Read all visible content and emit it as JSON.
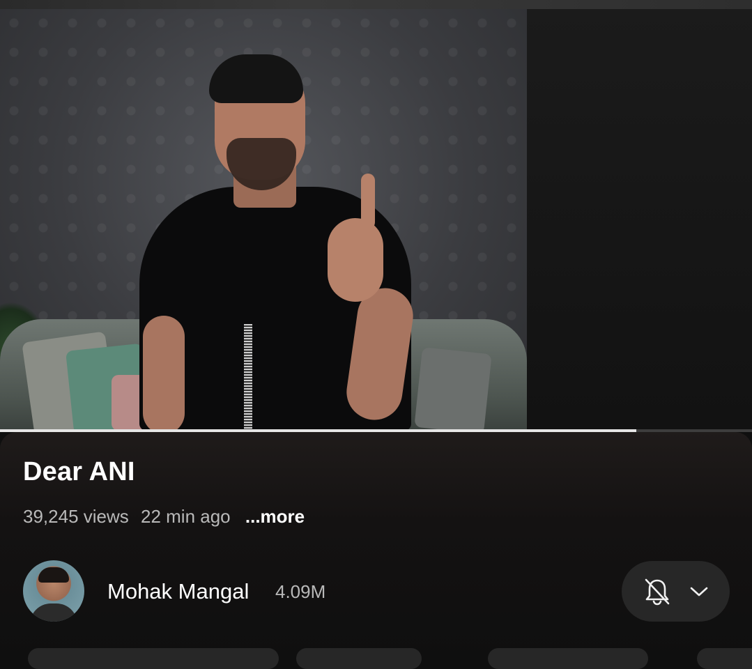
{
  "video": {
    "title": "Dear ANI",
    "views": "39,245 views",
    "time_ago": "22 min ago",
    "more_label": "...more",
    "progress_fraction": 0.846
  },
  "channel": {
    "name": "Mohak Mangal",
    "subscribers": "4.09M"
  },
  "subscribe_button": {
    "icon_bell": "bell-off-icon",
    "icon_chevron": "chevron-down-icon"
  },
  "colors": {
    "background": "#0f0f0f",
    "progress": "#e6e6e6",
    "button_bg": "#272727"
  }
}
